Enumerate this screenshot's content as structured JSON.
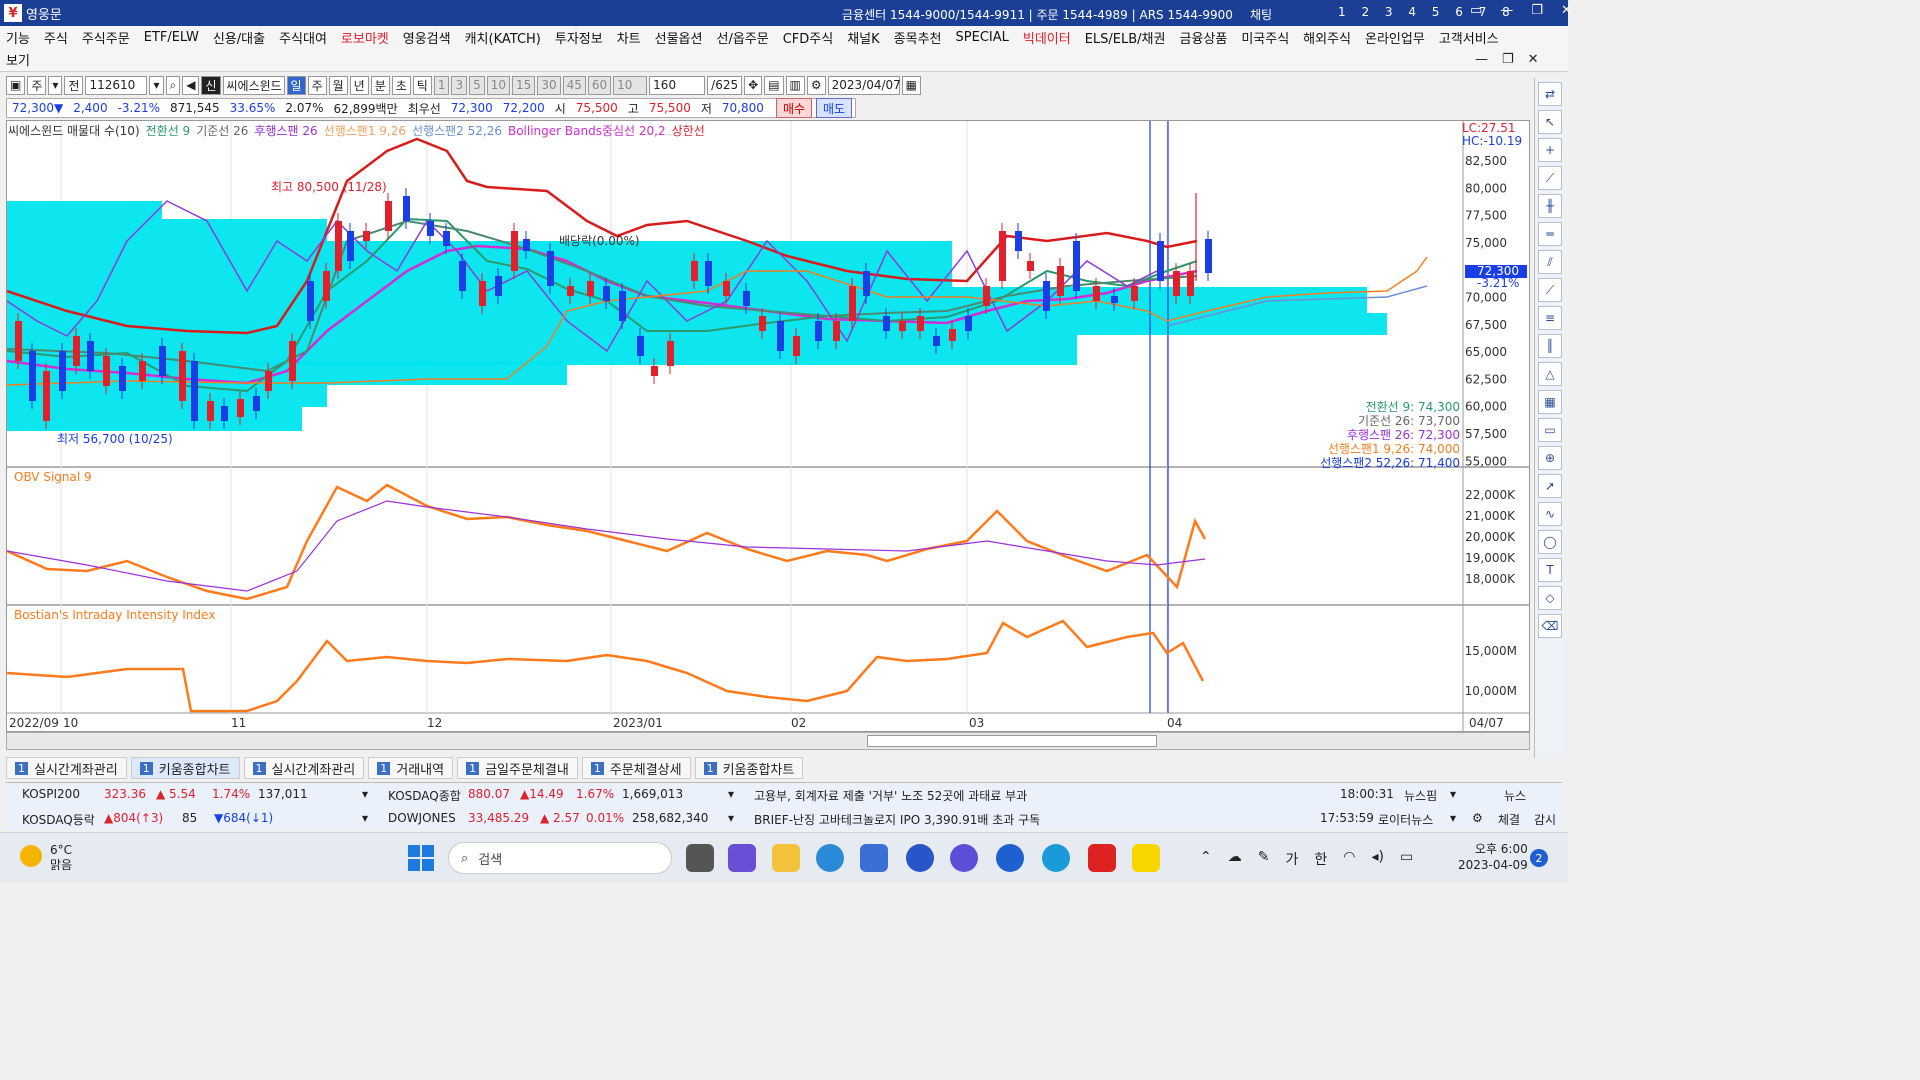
{
  "window": {
    "title": "영웅문",
    "info": "금융센터 1544-9000/1544-9911 | 주문 1544-4989 | ARS 1544-9900",
    "chat": "채팅",
    "screens": "1 2 3 4 5 6 7 8"
  },
  "menu": {
    "row1": [
      "기능",
      "주식",
      "주식주문",
      "ETF/ELW",
      "신용/대출",
      "주식대여",
      "로보마켓",
      "영웅검색",
      "캐치(KATCH)",
      "투자정보",
      "차트",
      "선물옵션",
      "선/옵주문",
      "CFD주식",
      "채널K",
      "종목추천",
      "SPECIAL",
      "빅데이터",
      "ELS/ELB/채권",
      "금융상품",
      "미국주식",
      "해외주식",
      "온라인업무",
      "고객서비스"
    ],
    "row2": [
      "보기"
    ],
    "red_items": [
      "로보마켓",
      "빅데이터"
    ]
  },
  "toolbar": {
    "period_label": "주",
    "all_label": "전",
    "code": "112610",
    "new_label": "신",
    "name": "씨에스윈드",
    "intervals": [
      "일",
      "주",
      "월",
      "년",
      "분",
      "초",
      "틱"
    ],
    "numbers": [
      "1",
      "3",
      "5",
      "10",
      "15",
      "30",
      "45",
      "60"
    ],
    "custom_value": "10",
    "count": "160",
    "total": "/625",
    "date": "2023/04/07"
  },
  "quote": {
    "price": "72,300▼",
    "change": "2,400",
    "rate": "-3.21%",
    "volume": "871,545",
    "vol_ratio": "33.65%",
    "turnover": "2.07%",
    "amount": "62,899백만",
    "bid_label": "최우선",
    "ask": "72,300",
    "bid": "72,200",
    "open_label": "시",
    "open": "75,500",
    "high_label": "고",
    "high": "75,500",
    "low_label": "저",
    "low": "70,800",
    "buy": "매수",
    "sell": "매도"
  },
  "legend": {
    "items": [
      {
        "text": "씨에스윈드 매물대 수(10)",
        "color": "#333333"
      },
      {
        "text": "전환선 9",
        "color": "#2a9a6e"
      },
      {
        "text": "기준선 26",
        "color": "#666666"
      },
      {
        "text": "후행스팬 26",
        "color": "#9b30d9"
      },
      {
        "text": "선행스팬1 9,26",
        "color": "#f0a060"
      },
      {
        "text": "선행스팬2 52,26",
        "color": "#6a8fd8"
      },
      {
        "text": "Bollinger Bands중심선 20,2",
        "color": "#d32cd3"
      },
      {
        "text": "상한선",
        "color": "#e0202a"
      }
    ],
    "lc": "LC:27.51",
    "hc": "HC:-10.19"
  },
  "annotations": {
    "high": "최고 80,500 (11/28)",
    "low": "최저 56,700 (10/25)",
    "dividend": "배당락(0.00%)"
  },
  "values_box": [
    {
      "text": "전환선 9: 74,300",
      "color": "#2a9a6e"
    },
    {
      "text": "기준선 26: 73,700",
      "color": "#666666"
    },
    {
      "text": "후행스팬 26: 72,300",
      "color": "#9b30d9"
    },
    {
      "text": "선행스팬1 9,26: 74,000",
      "color": "#f07f20"
    },
    {
      "text": "선행스팬2 52,26: 71,400",
      "color": "#1a3ee6"
    }
  ],
  "price_axis": {
    "labels": [
      "82,500",
      "80,000",
      "77,500",
      "75,000",
      "72,500",
      "70,000",
      "67,500",
      "65,000",
      "62,500",
      "60,000",
      "57,500",
      "55,000"
    ],
    "current": "72,300",
    "current_rate": "-3.21%"
  },
  "obv_panel": {
    "title": "OBV  Signal 9",
    "labels": [
      "22,000K",
      "21,000K",
      "20,000K",
      "19,000K",
      "18,000K"
    ]
  },
  "bii_panel": {
    "title": "Bostian's Intraday Intensity Index",
    "labels": [
      "15,000M",
      "10,000M"
    ]
  },
  "x_axis": [
    "2022/09",
    "10",
    "11",
    "12",
    "2023/01",
    "02",
    "03",
    "04"
  ],
  "x_axis_right": "04/07",
  "tabs": [
    {
      "n": "1",
      "label": "실시간계좌관리"
    },
    {
      "n": "1",
      "label": "키움종합차트"
    },
    {
      "n": "1",
      "label": "실시간계좌관리"
    },
    {
      "n": "1",
      "label": "거래내역"
    },
    {
      "n": "1",
      "label": "금일주문체결내"
    },
    {
      "n": "1",
      "label": "주문체결상세"
    },
    {
      "n": "1",
      "label": "키움종합차트"
    }
  ],
  "ticker": {
    "row1": {
      "name": "KOSPI200",
      "value": "323.36",
      "change": "▲ 5.54",
      "rate": "1.74%",
      "volume": "137,011",
      "name2": "KOSDAQ종합",
      "value2": "880.07",
      "change2": "▲14.49",
      "rate2": "1.67%",
      "volume2": "1,669,013",
      "news": "고용부, 회계자료 제출 '거부' 노조 52곳에 과태료 부과",
      "time": "18:00:31",
      "source": "뉴스핌",
      "btn": "뉴스"
    },
    "row2": {
      "name": "KOSDAQ등락",
      "up": "▲804(↑3)",
      "flat": "85",
      "down": "▼684(↓1)",
      "name2": "DOWJONES",
      "value2": "33,485.29",
      "change2": "▲ 2.57",
      "rate2": "0.01%",
      "volume2": "258,682,340",
      "news": "BRIEF-난징 고바테크놀로지 IPO 3,390.91배 초과 구독",
      "time": "17:53:59",
      "source": "로이터뉴스",
      "btn1": "체결",
      "btn2": "감시"
    }
  },
  "taskbar": {
    "temp": "6°C",
    "weather": "맑음",
    "search": "검색",
    "ime1": "가",
    "ime2": "한",
    "time": "오후 6:00",
    "date": "2023-04-09",
    "notif": "2"
  },
  "colors": {
    "up": "#e0202a",
    "down": "#1a3ee6",
    "volume_profile": "#00e5ee",
    "titlebar": "#1c3f96"
  }
}
